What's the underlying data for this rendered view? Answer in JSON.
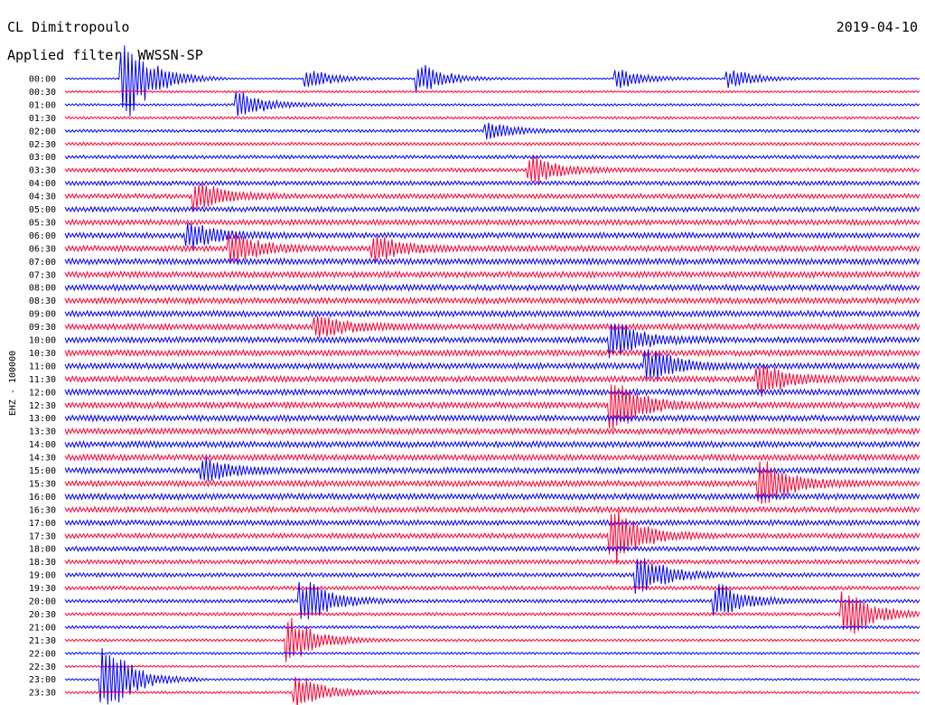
{
  "header": {
    "station": "CL Dimitropoulo",
    "filter": "Applied filter  WWSSN-SP",
    "date": "2019-04-10"
  },
  "chart_data": {
    "type": "line",
    "channel_label": "EHZ - 100000",
    "rows": [
      "00:00",
      "00:30",
      "01:00",
      "01:30",
      "02:00",
      "02:30",
      "03:00",
      "03:30",
      "04:00",
      "04:30",
      "05:00",
      "05:30",
      "06:00",
      "06:30",
      "07:00",
      "07:30",
      "08:00",
      "08:30",
      "09:00",
      "09:30",
      "10:00",
      "10:30",
      "11:00",
      "11:30",
      "12:00",
      "12:30",
      "13:00",
      "13:30",
      "14:00",
      "14:30",
      "15:00",
      "15:30",
      "16:00",
      "16:30",
      "17:00",
      "17:30",
      "18:00",
      "18:30",
      "19:00",
      "19:30",
      "20:00",
      "20:30",
      "21:00",
      "21:30",
      "22:00",
      "22:30",
      "23:00",
      "23:30"
    ],
    "row_minutes": 30,
    "series_colors": [
      "#0000ff",
      "#ff0033"
    ],
    "noise_level": [
      0.25,
      0.35,
      0.4,
      0.45,
      0.5,
      0.55,
      0.6,
      0.7,
      0.75,
      0.8,
      0.85,
      0.9,
      0.95,
      1.0,
      1.0,
      1.0,
      1.0,
      1.0,
      1.0,
      1.0,
      1.0,
      1.0,
      1.0,
      1.0,
      1.0,
      1.0,
      1.0,
      1.0,
      1.0,
      1.0,
      1.0,
      1.0,
      1.0,
      0.95,
      0.9,
      0.85,
      0.8,
      0.75,
      0.7,
      0.65,
      0.6,
      0.55,
      0.5,
      0.45,
      0.4,
      0.35,
      0.35,
      0.4
    ],
    "events": [
      {
        "row": 0,
        "minute": 2.2,
        "amp": 8.0
      },
      {
        "row": 0,
        "minute": 8.7,
        "amp": 1.6
      },
      {
        "row": 0,
        "minute": 12.6,
        "amp": 2.6
      },
      {
        "row": 0,
        "minute": 19.6,
        "amp": 1.7
      },
      {
        "row": 0,
        "minute": 23.5,
        "amp": 1.6
      },
      {
        "row": 2,
        "minute": 6.3,
        "amp": 2.2
      },
      {
        "row": 4,
        "minute": 15.0,
        "amp": 1.3
      },
      {
        "row": 7,
        "minute": 16.5,
        "amp": 2.4
      },
      {
        "row": 9,
        "minute": 4.8,
        "amp": 2.5
      },
      {
        "row": 12,
        "minute": 4.5,
        "amp": 2.2
      },
      {
        "row": 13,
        "minute": 6.0,
        "amp": 2.6
      },
      {
        "row": 13,
        "minute": 11.0,
        "amp": 2.4
      },
      {
        "row": 19,
        "minute": 9.0,
        "amp": 2.2
      },
      {
        "row": 20,
        "minute": 19.4,
        "amp": 3.0
      },
      {
        "row": 22,
        "minute": 20.6,
        "amp": 3.2
      },
      {
        "row": 23,
        "minute": 24.5,
        "amp": 3.0
      },
      {
        "row": 25,
        "minute": 19.4,
        "amp": 4.5
      },
      {
        "row": 30,
        "minute": 5.0,
        "amp": 2.0
      },
      {
        "row": 31,
        "minute": 24.6,
        "amp": 4.2
      },
      {
        "row": 35,
        "minute": 19.4,
        "amp": 5.0
      },
      {
        "row": 38,
        "minute": 20.3,
        "amp": 3.5
      },
      {
        "row": 40,
        "minute": 8.5,
        "amp": 4.0
      },
      {
        "row": 40,
        "minute": 23.0,
        "amp": 3.2
      },
      {
        "row": 41,
        "minute": 27.5,
        "amp": 4.5
      },
      {
        "row": 43,
        "minute": 8.0,
        "amp": 4.0
      },
      {
        "row": 46,
        "minute": 1.5,
        "amp": 6.5
      },
      {
        "row": 47,
        "minute": 8.3,
        "amp": 3.0
      }
    ]
  }
}
